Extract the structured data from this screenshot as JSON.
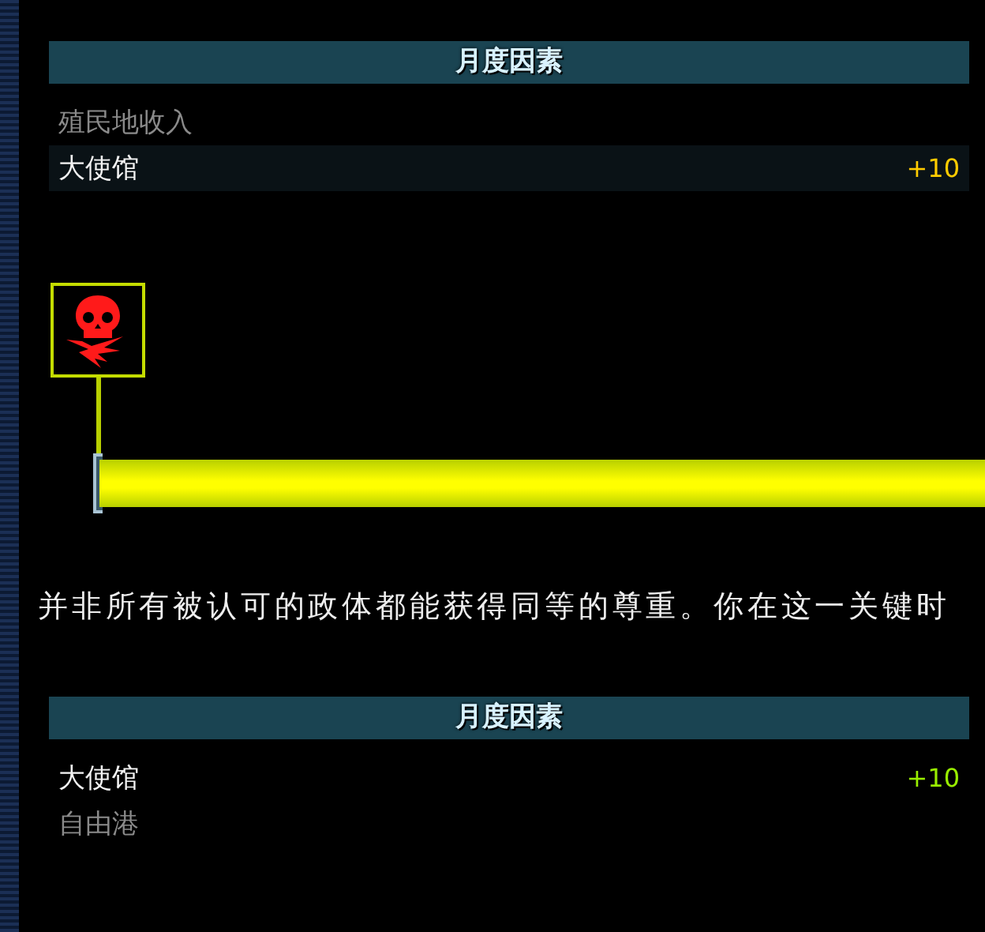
{
  "panels": [
    {
      "header": "月度因素",
      "rows": [
        {
          "label": "殖民地收入",
          "active": false,
          "highlighted": false
        },
        {
          "label": "大使馆",
          "active": true,
          "highlighted": true,
          "value": "+10",
          "color": "#ffcc00"
        }
      ]
    },
    {
      "header": "月度因素",
      "rows": [
        {
          "label": "大使馆",
          "active": true,
          "highlighted": false,
          "value": "+10",
          "color": "#99ee00"
        },
        {
          "label": "自由港",
          "active": false,
          "highlighted": false
        }
      ]
    }
  ],
  "meter": {
    "level": 1
  },
  "description": "并非所有被认可的政体都能获得同等的尊重。你在这一关键时"
}
